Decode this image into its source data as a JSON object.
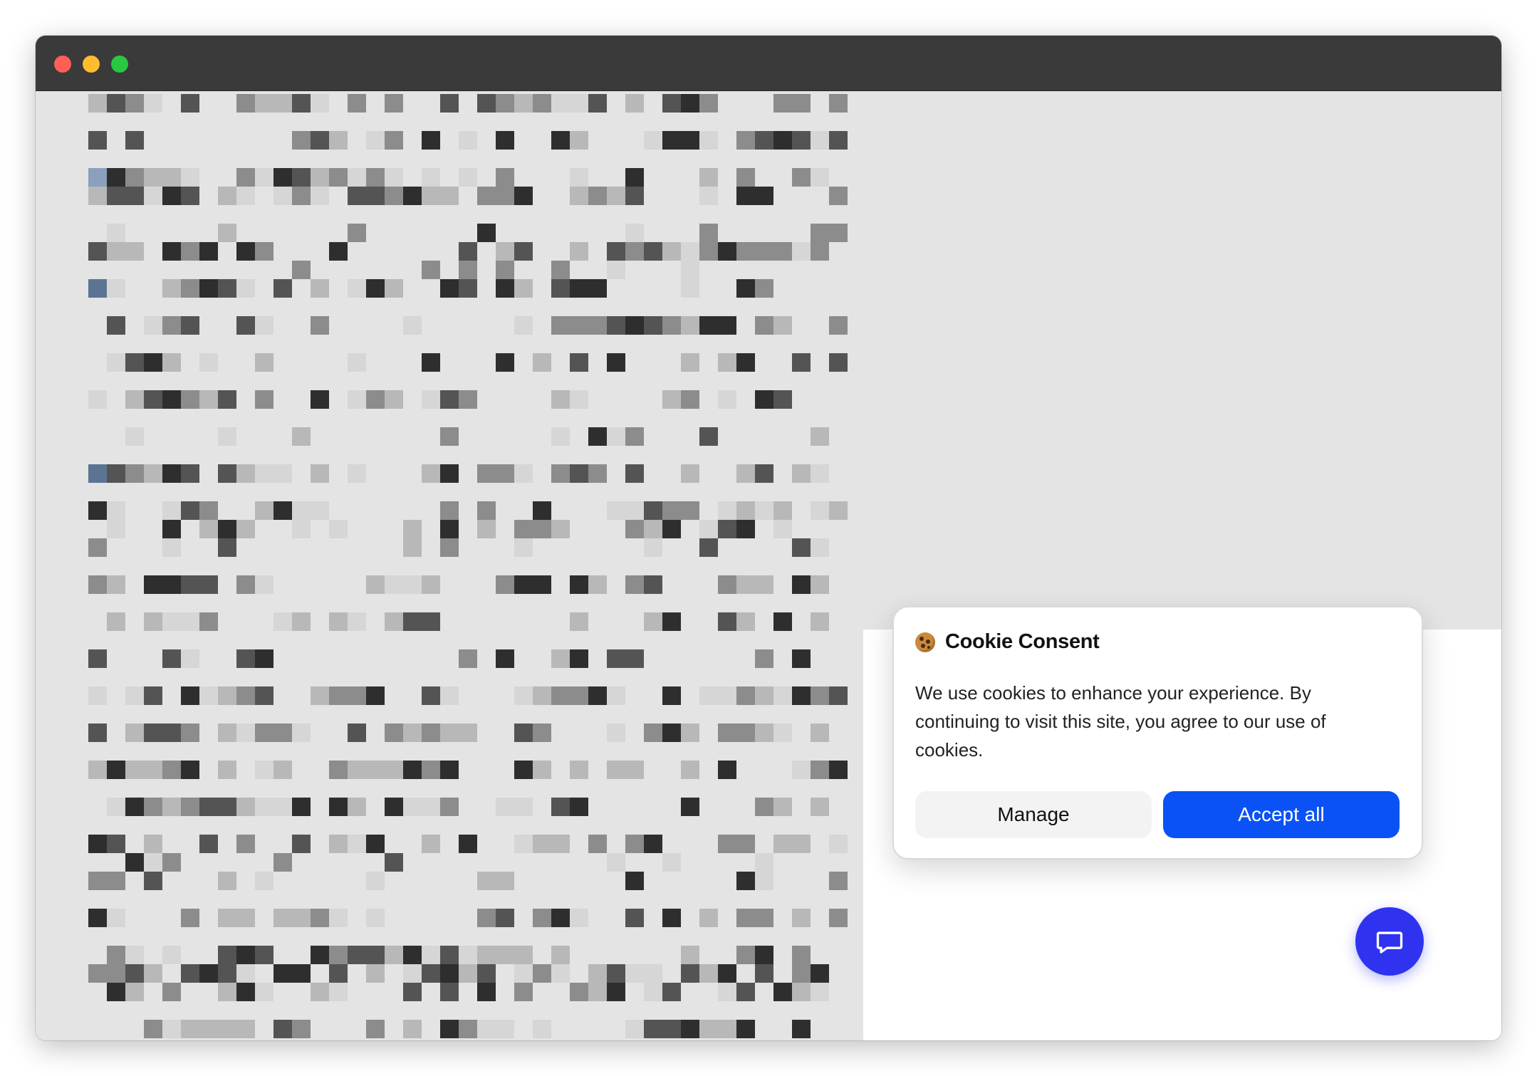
{
  "window": {
    "controls": [
      "close",
      "minimize",
      "maximize"
    ],
    "colors": {
      "titlebar": "#3a3a3a",
      "close": "#ff5f57",
      "minimize": "#febc2e",
      "maximize": "#28c840"
    }
  },
  "page": {
    "content_state": "pixelated-obscured",
    "pixel_colors": [
      "#2e2e2e",
      "#545454",
      "#8c8c8c",
      "#b8b8b8",
      "#d6d6d6",
      "#5c7494",
      "#8aa0bc"
    ]
  },
  "cookie_banner": {
    "icon": "cookie-icon",
    "title": "Cookie Consent",
    "message": "We use cookies to enhance your experience. By continuing to visit this site, you agree to our use of cookies.",
    "manage_label": "Manage",
    "accept_label": "Accept all",
    "colors": {
      "accept": "#0a52f5",
      "manage": "#f3f3f3"
    }
  },
  "chat_widget": {
    "icon": "chat-bubble-icon",
    "color": "#2f33f0"
  }
}
